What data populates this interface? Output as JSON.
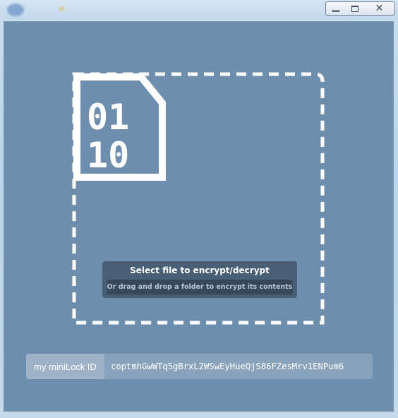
{
  "window": {
    "minimize_icon": "minimize-icon",
    "maximize_icon": "maximize-icon",
    "close_icon": "close-icon"
  },
  "drop_zone": {
    "file_icon": "binary-file-icon",
    "file_icon_digits_row1": "01",
    "file_icon_digits_row2": "10",
    "title": "Select file to encrypt/decrypt",
    "subtitle": "Or drag and drop a folder to encrypt its contents"
  },
  "minilock_id": {
    "label": "my miniLock ID",
    "value": "coptmhGwWTq5gBrxL2WSwEyHueQjS86FZesMrv1ENPum6"
  },
  "colors": {
    "background": "#6e8eae",
    "dashed_border": "#ffffff",
    "id_label_bg": "#9db2c7",
    "id_value_bg": "#8aa3bc"
  }
}
